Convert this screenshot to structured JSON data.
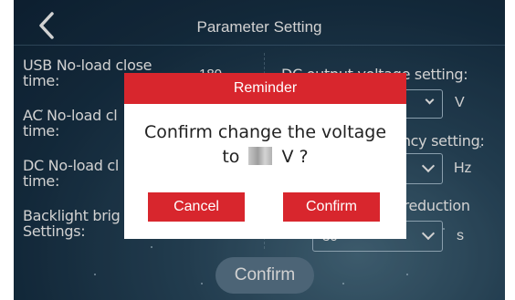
{
  "header": {
    "title": "Parameter Setting"
  },
  "left_rows": [
    {
      "label_line1": "USB No-load close",
      "label_line2": "time:",
      "value": "180"
    },
    {
      "label_line1": "AC No-load cl",
      "label_line2": "time:"
    },
    {
      "label_line1": "DC No-load cl",
      "label_line2": "time:"
    },
    {
      "label_line1": "Backlight brig",
      "label_line2": "Settings:"
    }
  ],
  "right_rows": [
    {
      "label": "DC output voltage setting:",
      "unit": "V"
    },
    {
      "label": "AC output frequency setting:",
      "unit": "Hz"
    },
    {
      "label": "Screen backlight reduction time:",
      "unit": "s",
      "value": "30"
    }
  ],
  "bottom": {
    "confirm_label": "Confirm"
  },
  "dialog": {
    "title": "Reminder",
    "message_line1": "Confirm change the voltage",
    "message_prefix": "to",
    "message_suffix": "V ?",
    "cancel_label": "Cancel",
    "confirm_label": "Confirm"
  },
  "colors": {
    "accent_red": "#d8262d",
    "bottom_button": "#5d7b91",
    "background": "#173146"
  },
  "icons": {
    "back": "chevron-left-icon",
    "dropdown": "chevron-down-icon"
  }
}
